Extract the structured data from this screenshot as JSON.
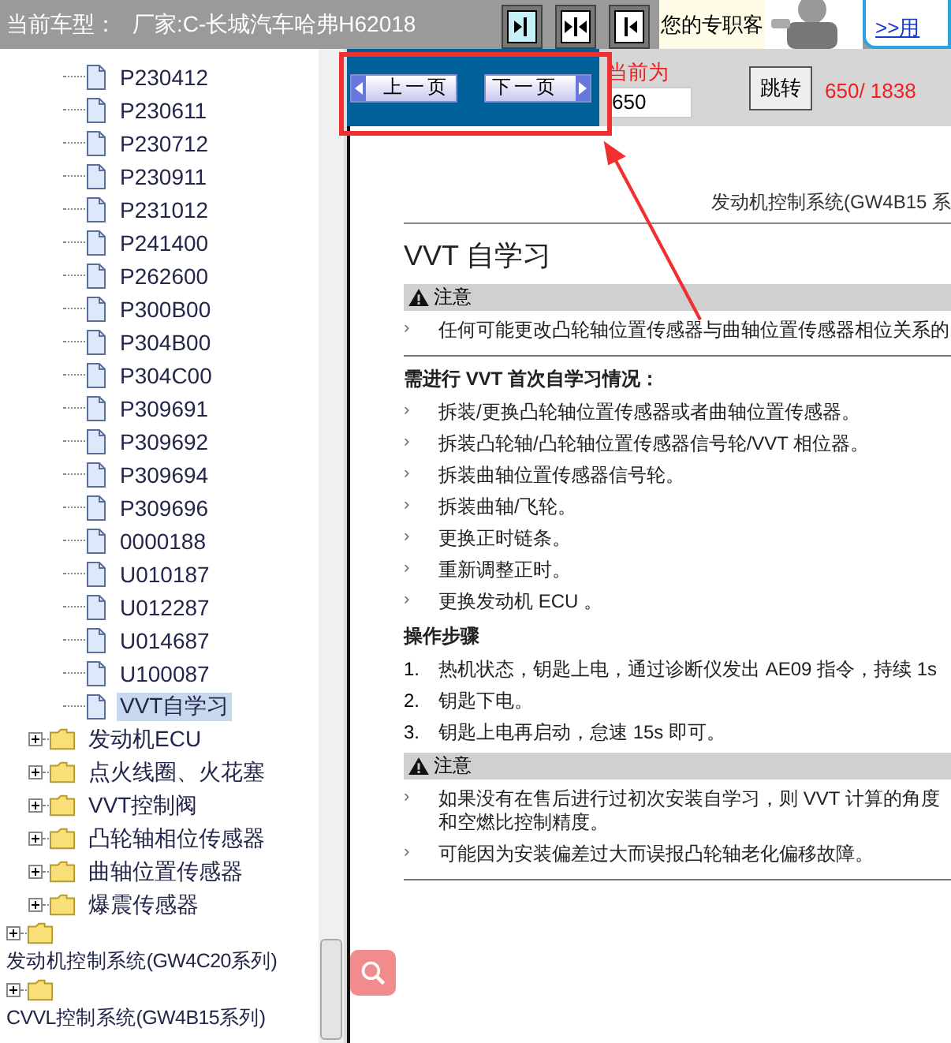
{
  "header": {
    "vehicle_label": "当前车型：",
    "vehicle": "厂家:C-长城汽车哈弗H62018",
    "support_text": "您的专职客",
    "support_link": ">>用"
  },
  "tree": {
    "items": [
      {
        "children": [
          {
            "children": [
              {
                "kind": "page",
                "label": "P230412",
                "selected": false
              },
              {
                "kind": "page",
                "label": "P230611",
                "selected": false
              },
              {
                "kind": "page",
                "label": "P230712",
                "selected": false
              },
              {
                "kind": "page",
                "label": "P230911",
                "selected": false
              },
              {
                "kind": "page",
                "label": "P231012",
                "selected": false
              },
              {
                "kind": "page",
                "label": "P241400",
                "selected": false
              },
              {
                "kind": "page",
                "label": "P262600",
                "selected": false
              },
              {
                "kind": "page",
                "label": "P300B00",
                "selected": false
              },
              {
                "kind": "page",
                "label": "P304B00",
                "selected": false
              },
              {
                "kind": "page",
                "label": "P304C00",
                "selected": false
              },
              {
                "kind": "page",
                "label": "P309691",
                "selected": false
              },
              {
                "kind": "page",
                "label": "P309692",
                "selected": false
              },
              {
                "kind": "page",
                "label": "P309694",
                "selected": false
              },
              {
                "kind": "page",
                "label": "P309696",
                "selected": false
              },
              {
                "kind": "page",
                "label": "0000188",
                "selected": false
              },
              {
                "kind": "page",
                "label": "U010187",
                "selected": false
              },
              {
                "kind": "page",
                "label": "U012287",
                "selected": false
              },
              {
                "kind": "page",
                "label": "U014687",
                "selected": false
              },
              {
                "kind": "page",
                "label": "U100087",
                "selected": false
              },
              {
                "kind": "page",
                "label": "VVT自学习",
                "selected": true
              }
            ]
          },
          {
            "kind": "folder",
            "label": "发动机ECU",
            "expanded": false
          },
          {
            "kind": "folder",
            "label": "点火线圈、火花塞",
            "expanded": false
          },
          {
            "kind": "folder",
            "label": "VVT控制阀",
            "expanded": false
          },
          {
            "kind": "folder",
            "label": "凸轮轴相位传感器",
            "expanded": false
          },
          {
            "kind": "folder",
            "label": "曲轴位置传感器",
            "expanded": false
          },
          {
            "kind": "folder",
            "label": "爆震传感器",
            "expanded": false
          }
        ]
      },
      {
        "kind": "folder",
        "label": "发动机控制系统(GW4C20系列)",
        "expanded": false
      },
      {
        "kind": "folder",
        "label": "CVVL控制系统(GW4B15系列)",
        "expanded": false
      }
    ]
  },
  "pager": {
    "prev": "上一页",
    "next": "下一页",
    "current_label": "当前为",
    "page_input": "650",
    "go": "跳转",
    "position": "650/ 1838"
  },
  "document": {
    "running_head": "发动机控制系统(GW4B15 系",
    "title": "VVT 自学习",
    "blocks": [
      {
        "kind": "note",
        "label": "注意",
        "marker": "›",
        "items": [
          "任何可能更改凸轮轴位置传感器与曲轴位置传感器相位关系的"
        ]
      },
      {
        "kind": "heading",
        "text": "需进行 VVT 首次自学习情况："
      },
      {
        "kind": "bullets",
        "marker": "›",
        "items": [
          "拆装/更换凸轮轴位置传感器或者曲轴位置传感器。",
          "拆装凸轮轴/凸轮轴位置传感器信号轮/VVT 相位器。",
          "拆装曲轴位置传感器信号轮。",
          "拆装曲轴/飞轮。",
          "更换正时链条。",
          "重新调整正时。",
          "更换发动机 ECU 。"
        ]
      },
      {
        "kind": "heading",
        "text": "操作步骤"
      },
      {
        "kind": "steps",
        "items": [
          {
            "number": "1.",
            "text": "热机状态，钥匙上电，通过诊断仪发出 AE09 指令，持续 1s"
          },
          {
            "number": "2.",
            "text": "钥匙下电。"
          },
          {
            "number": "3.",
            "text": "钥匙上电再启动，怠速 15s 即可。"
          }
        ]
      },
      {
        "kind": "note",
        "label": "注意",
        "marker": "›",
        "items": [
          [
            "如果没有在售后进行过初次安装自学习，则 VVT 计算的角度",
            "和空燃比控制精度。"
          ],
          "可能因为安装偏差过大而误报凸轮轴老化偏移故障。"
        ]
      }
    ]
  }
}
